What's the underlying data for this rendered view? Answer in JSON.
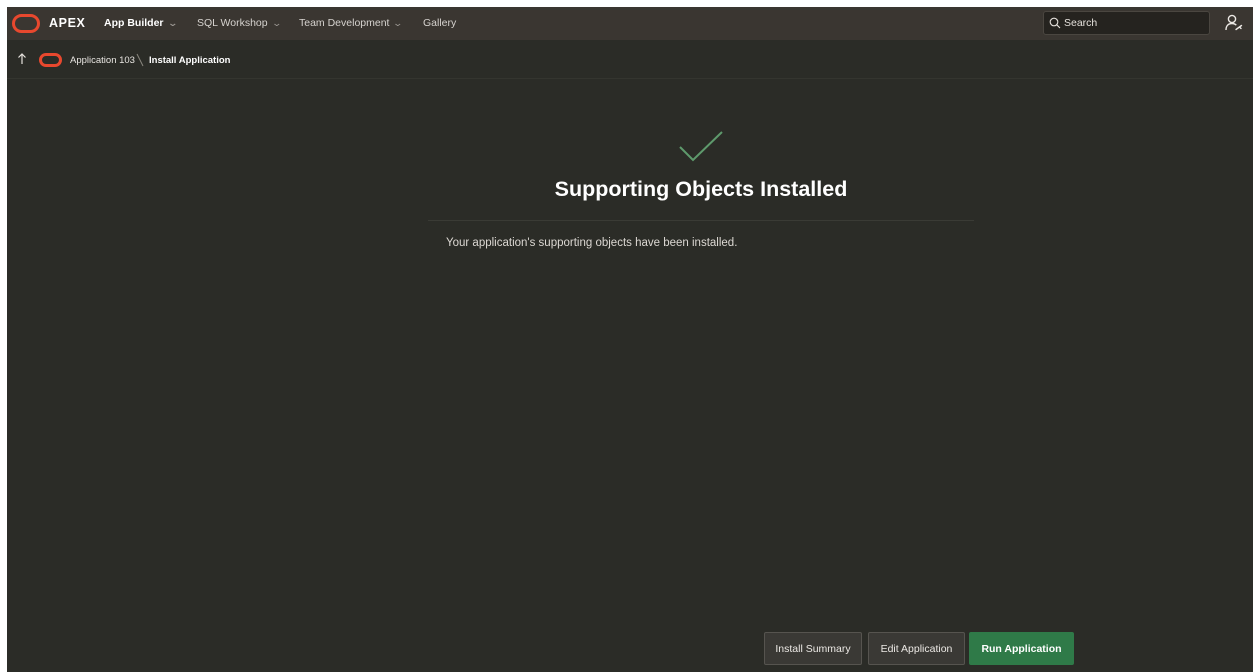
{
  "topbar": {
    "brand": "APEX",
    "nav": [
      {
        "label": "App Builder",
        "active": true,
        "has_menu": true
      },
      {
        "label": "SQL Workshop",
        "active": false,
        "has_menu": true
      },
      {
        "label": "Team Development",
        "active": false,
        "has_menu": true
      },
      {
        "label": "Gallery",
        "active": false,
        "has_menu": false
      }
    ],
    "search": {
      "placeholder": "Search",
      "icon": "search-icon"
    },
    "user_icon": "user-icon"
  },
  "breadcrumb": {
    "parent": "Application 103",
    "current": "Install Application"
  },
  "region": {
    "title": "Supporting Objects Installed",
    "message": "Your application's supporting objects have been installed.",
    "status_icon": "check-icon"
  },
  "buttons": {
    "install_summary": "Install Summary",
    "edit_application": "Edit Application",
    "run_application": "Run Application"
  },
  "colors": {
    "background": "#2b2c27",
    "header": "#3a3631",
    "brand_accent": "#e8482e",
    "success": "#5e9a6c",
    "primary_button": "#2f7a48"
  }
}
